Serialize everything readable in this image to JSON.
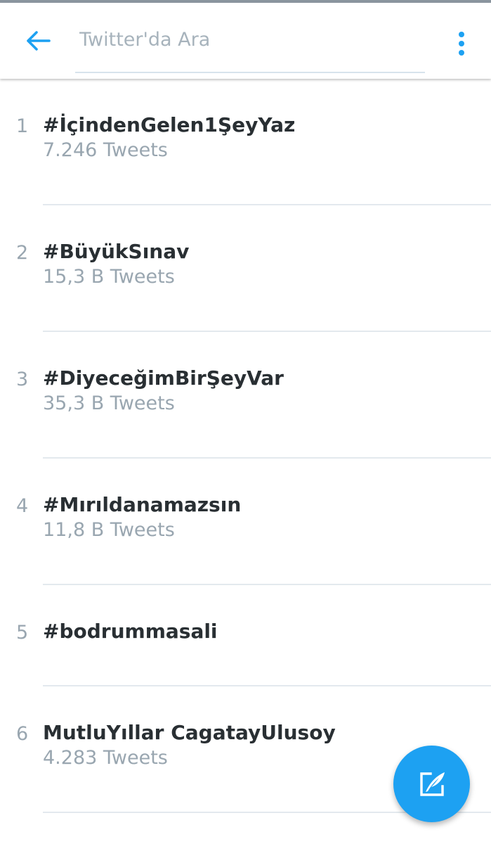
{
  "search": {
    "placeholder": "Twitter'da Ara"
  },
  "icons": {
    "back": "arrow-left-icon",
    "menu": "more-vert-icon",
    "compose": "compose-tweet-icon"
  },
  "colors": {
    "accent": "#1da1f2",
    "text_primary": "#292f33",
    "text_secondary": "#99a6b0"
  },
  "trends": [
    {
      "rank": "1",
      "name": "#İçindenGelen1ŞeyYaz",
      "count": "7.246 Tweets"
    },
    {
      "rank": "2",
      "name": "#BüyükSınav",
      "count": "15,3 B Tweets"
    },
    {
      "rank": "3",
      "name": "#DiyeceğimBirŞeyVar",
      "count": "35,3 B Tweets"
    },
    {
      "rank": "4",
      "name": "#Mırıldanamazsın",
      "count": "11,8 B Tweets"
    },
    {
      "rank": "5",
      "name": "#bodrummasali",
      "count": ""
    },
    {
      "rank": "6",
      "name": "MutluYıllar CagatayUlusoy",
      "count": "4.283 Tweets"
    }
  ]
}
